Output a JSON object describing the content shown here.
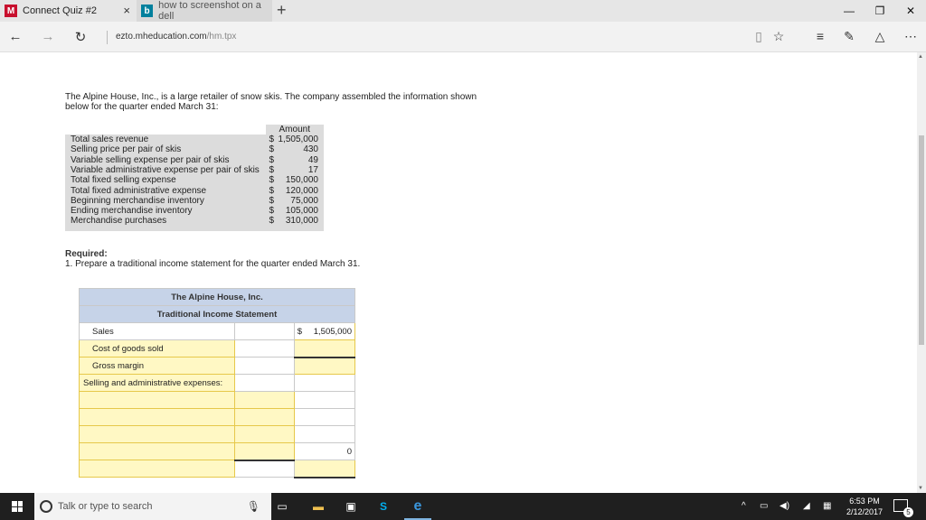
{
  "tabs": [
    {
      "icon": "M",
      "title": "Connect Quiz #2",
      "close": "×"
    },
    {
      "icon": "b",
      "title": "how to screenshot on a dell",
      "close": "×"
    }
  ],
  "new_tab_symbol": "+",
  "window_controls": {
    "minimize": "—",
    "restore": "❐",
    "close": "✕"
  },
  "address": {
    "domain": "ezto.mheducation.com",
    "path": "/hm.tpx"
  },
  "problem": {
    "intro": "The Alpine House, Inc., is a large retailer of snow skis. The company assembled the information shown below for the quarter ended March 31:",
    "amount_header": "Amount",
    "items": [
      {
        "label": "Total sales revenue",
        "currency": "$",
        "value": "1,505,000"
      },
      {
        "label": "Selling price per pair of skis",
        "currency": "$",
        "value": "430"
      },
      {
        "label": "Variable selling expense per pair of skis",
        "currency": "$",
        "value": "49"
      },
      {
        "label": "Variable administrative expense per pair of skis",
        "currency": "$",
        "value": "17"
      },
      {
        "label": "Total fixed selling expense",
        "currency": "$",
        "value": "150,000"
      },
      {
        "label": "Total fixed administrative expense",
        "currency": "$",
        "value": "120,000"
      },
      {
        "label": "Beginning merchandise inventory",
        "currency": "$",
        "value": "75,000"
      },
      {
        "label": "Ending merchandise inventory",
        "currency": "$",
        "value": "105,000"
      },
      {
        "label": "Merchandise purchases",
        "currency": "$",
        "value": "310,000"
      }
    ],
    "required_label": "Required:",
    "required_text": "1. Prepare a traditional income statement for the quarter ended March 31."
  },
  "statement": {
    "company": "The Alpine House, Inc.",
    "title": "Traditional Income Statement",
    "rows": {
      "sales": {
        "label": "Sales",
        "currency": "$",
        "value": "1,505,000"
      },
      "cogs": {
        "label": "Cost of goods sold"
      },
      "gross": {
        "label": "Gross margin"
      },
      "sga": {
        "label": "Selling and administrative expenses:"
      },
      "total_value": "0"
    }
  },
  "taskbar": {
    "search_placeholder": "Talk or type to search",
    "time": "6:53 PM",
    "date": "2/12/2017",
    "notification_count": "5"
  }
}
